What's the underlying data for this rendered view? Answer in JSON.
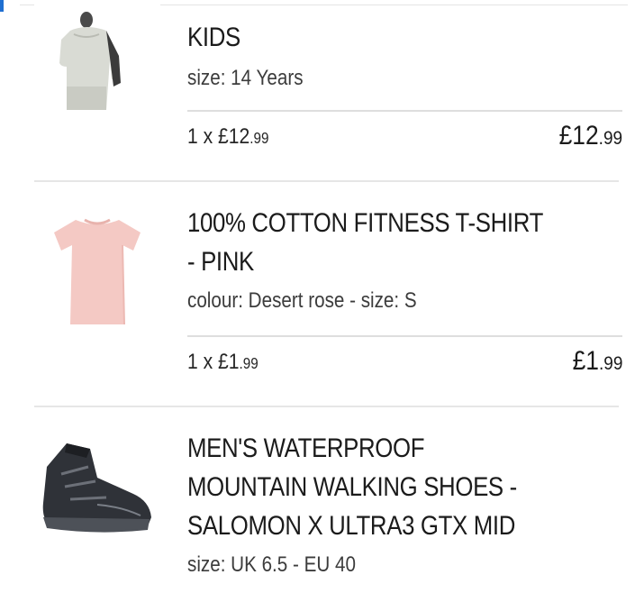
{
  "cart": {
    "items": [
      {
        "name": "KIDS",
        "variant": "size: 14 Years",
        "quantity_prefix": "1 x ",
        "unit_price_main": "£12",
        "unit_price_decimals": ".99",
        "line_total_main": "£12",
        "line_total_decimals": ".99",
        "image_icon": "kids-clothing-icon"
      },
      {
        "name_line1": "100% COTTON FITNESS T-SHIRT",
        "name_line2": "- PINK",
        "variant": "colour: Desert rose - size: S",
        "quantity_prefix": "1 x ",
        "unit_price_main": "£1",
        "unit_price_decimals": ".99",
        "line_total_main": "£1",
        "line_total_decimals": ".99",
        "image_icon": "pink-tshirt-icon"
      },
      {
        "name_line1": "MEN'S WATERPROOF",
        "name_line2": "MOUNTAIN WALKING SHOES -",
        "name_line3": "SALOMON X ULTRA3 GTX MID",
        "variant": "size: UK 6.5 - EU 40",
        "image_icon": "walking-shoe-icon"
      }
    ]
  },
  "colors": {
    "accent": "#1f6fd1",
    "text": "#1b1b1b",
    "divider": "#e6e6e6"
  }
}
